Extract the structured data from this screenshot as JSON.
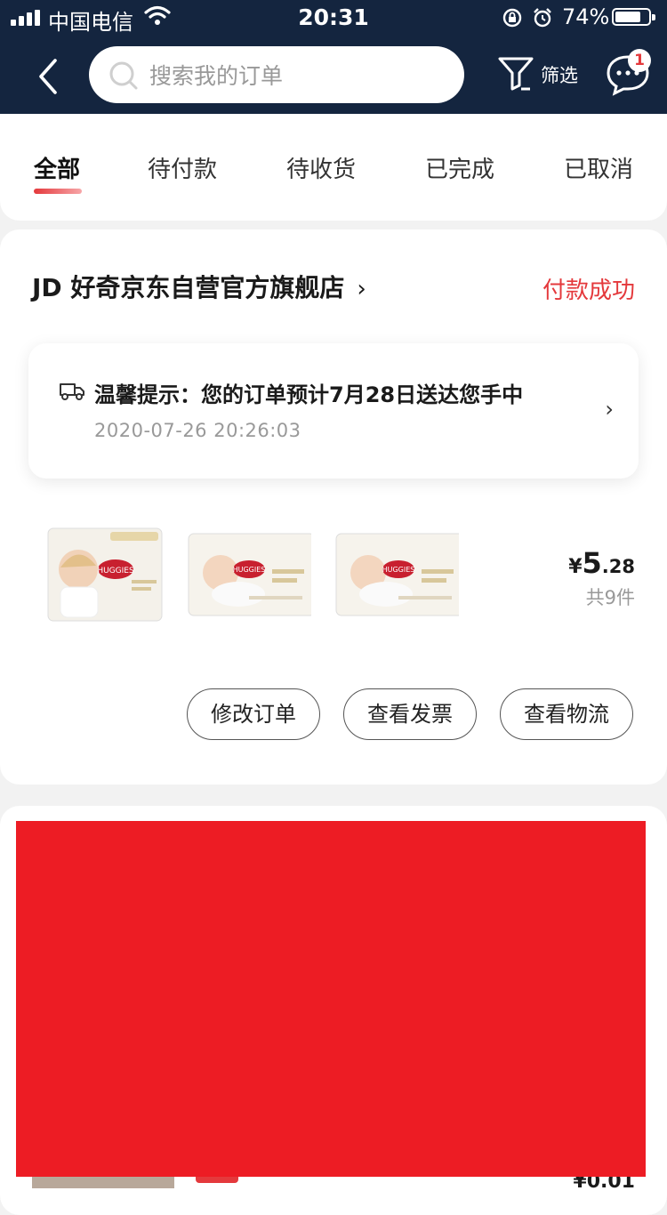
{
  "status_bar": {
    "carrier": "中国电信",
    "time": "20:31",
    "battery": "74%",
    "battery_level": 0.74
  },
  "header": {
    "search_placeholder": "搜索我的订单",
    "filter_label": "筛选",
    "message_badge": "1",
    "icons": [
      "back-icon",
      "search-icon",
      "filter-icon",
      "message-icon"
    ]
  },
  "tabs": [
    {
      "label": "全部",
      "active": true
    },
    {
      "label": "待付款"
    },
    {
      "label": "待收货"
    },
    {
      "label": "已完成"
    },
    {
      "label": "已取消"
    }
  ],
  "order": {
    "shop_name": "JD 好奇京东自营官方旗舰店",
    "shop_arrow": "›",
    "status": "付款成功",
    "notice_title": "温馨提示：您的订单预计7月28日送达您手中",
    "notice_time": "2020-07-26 20:26:03",
    "notice_arrow": "›",
    "price_currency": "¥",
    "price_integer": "5",
    "price_decimal": ".28",
    "item_count": "共9件",
    "products": [
      "HUGGIES",
      "HUGGIES",
      "HUGGIES"
    ],
    "buttons": [
      "修改订单",
      "查看发票",
      "查看物流"
    ]
  },
  "next_order": {
    "price_peek": "¥0.01"
  },
  "colors": {
    "header_bg": "#14253f",
    "accent_red": "#e4393c",
    "overlay_red": "#ed1c24"
  }
}
